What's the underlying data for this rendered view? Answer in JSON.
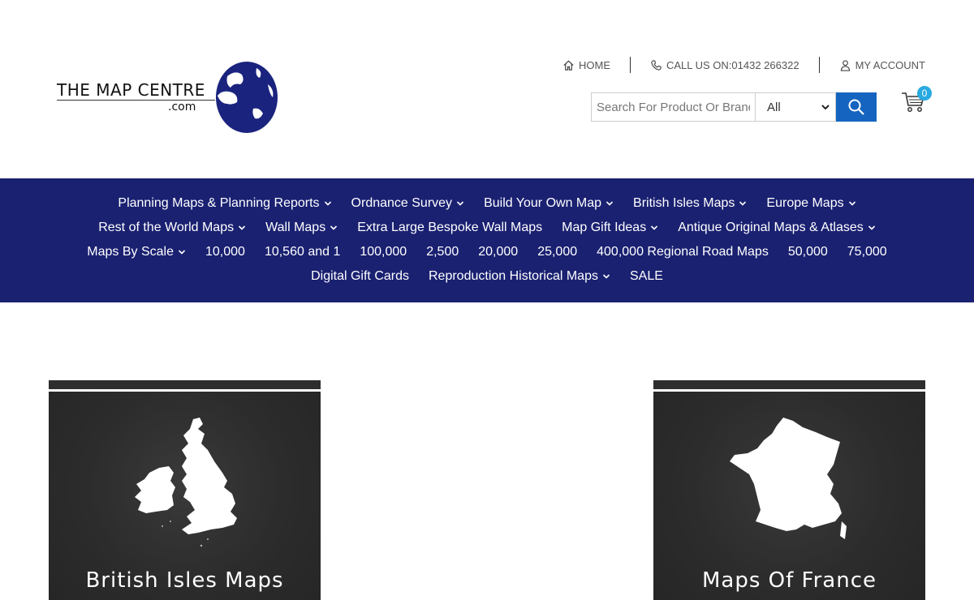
{
  "logo": {
    "name": "The Map Centre",
    "suffix": ".com"
  },
  "toplinks": {
    "home": "HOME",
    "call": "CALL US ON:01432 266322",
    "account": "MY ACCOUNT"
  },
  "search": {
    "placeholder": "Search For Product Or Brand",
    "category": "All"
  },
  "cart": {
    "count": "0"
  },
  "nav": {
    "rows": [
      [
        {
          "label": "Planning Maps & Planning Reports",
          "dropdown": true
        },
        {
          "label": "Ordnance Survey",
          "dropdown": true
        },
        {
          "label": "Build Your Own Map",
          "dropdown": true
        },
        {
          "label": "British Isles Maps",
          "dropdown": true
        },
        {
          "label": "Europe Maps",
          "dropdown": true
        }
      ],
      [
        {
          "label": "Rest of the World Maps",
          "dropdown": true
        },
        {
          "label": "Wall Maps",
          "dropdown": true
        },
        {
          "label": "Extra Large Bespoke Wall Maps",
          "dropdown": false
        },
        {
          "label": "Map Gift Ideas",
          "dropdown": true
        },
        {
          "label": "Antique Original Maps & Atlases",
          "dropdown": true
        }
      ],
      [
        {
          "label": "Maps By Scale",
          "dropdown": true
        },
        {
          "label": "10,000",
          "dropdown": false
        },
        {
          "label": "10,560 and 1",
          "dropdown": false
        },
        {
          "label": "100,000",
          "dropdown": false
        },
        {
          "label": "2,500",
          "dropdown": false
        },
        {
          "label": "20,000",
          "dropdown": false
        },
        {
          "label": "25,000",
          "dropdown": false
        },
        {
          "label": "400,000 Regional Road Maps",
          "dropdown": false
        },
        {
          "label": "50,000",
          "dropdown": false
        },
        {
          "label": "75,000",
          "dropdown": false
        }
      ],
      [
        {
          "label": "Digital Gift Cards",
          "dropdown": false
        },
        {
          "label": "Reproduction Historical Maps",
          "dropdown": true
        },
        {
          "label": "SALE",
          "dropdown": false
        }
      ]
    ]
  },
  "tiles": [
    {
      "title": "British Isles Maps",
      "icon": "british-isles-silhouette"
    },
    {
      "title": "Maps Of France",
      "icon": "france-silhouette"
    }
  ],
  "colors": {
    "nav_bg": "#1a2171",
    "accent": "#1565c0",
    "badge": "#27a9e1",
    "globe": "#1a237e"
  }
}
